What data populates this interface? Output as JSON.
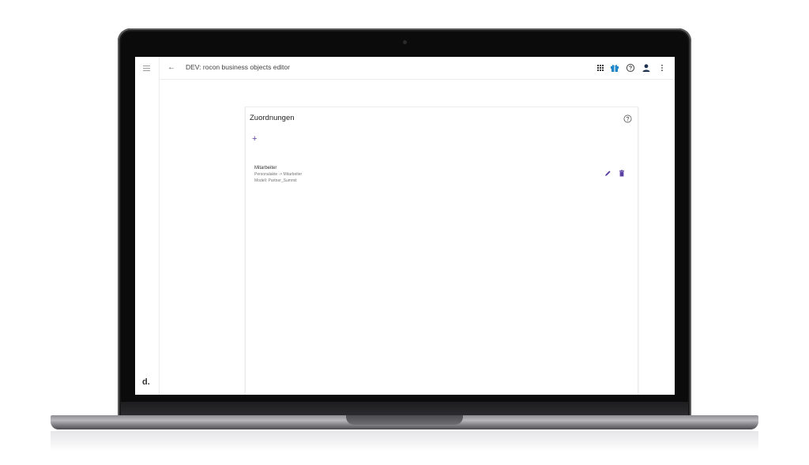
{
  "app": {
    "title": "DEV: rocon business objects editor",
    "brand": "d."
  },
  "page": {
    "heading": "Zuordnungen",
    "add_label": "+"
  },
  "assignments": [
    {
      "title": "Mitarbeiter",
      "mapping": "Personalakte -> Mitarbeiter",
      "model": "Modell: Partner_Summit"
    }
  ],
  "colors": {
    "accent": "#5b3fa3",
    "apps_icon": "#333333",
    "gift_icon": "#1e88c9",
    "account_icon": "#1f3350"
  },
  "icons": {
    "menu": "hamburger-icon",
    "back": "arrow-left-icon",
    "apps": "grid-icon",
    "news": "gift-icon",
    "help": "question-icon",
    "account": "person-icon",
    "more": "more-vert-icon",
    "edit": "pencil-icon",
    "delete": "trash-icon"
  }
}
